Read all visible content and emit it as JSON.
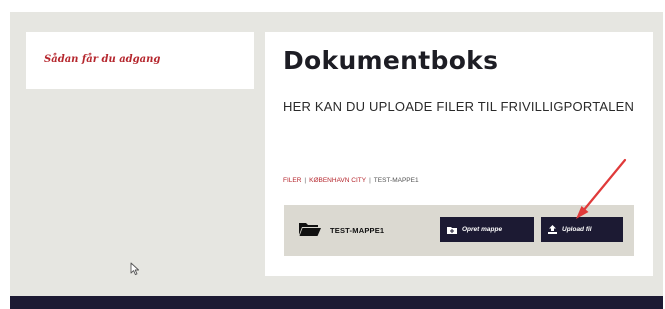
{
  "sidebar": {
    "link_label": "Sådan får du adgang"
  },
  "main": {
    "title": "Dokumentboks",
    "subtitle": "HER KAN DU UPLOADE FILER TIL FRIVILLIGPORTALEN",
    "breadcrumb": {
      "items": [
        "FILER",
        "KØBENHAVN CITY",
        "TEST-MAPPE1"
      ],
      "separator": "|"
    },
    "folder_bar": {
      "folder_name": "TEST-MAPPE1",
      "new_folder_label": "Opret mappe",
      "upload_label": "Upload fil"
    }
  },
  "colors": {
    "accent_red": "#b5262d",
    "navy": "#1c1a33",
    "stage_bg": "#e6e6e1",
    "folder_bar_bg": "#dbd9d1",
    "arrow_red": "#e03a3a"
  },
  "icons": [
    "folder-open-icon",
    "folder-plus-icon",
    "upload-icon",
    "mouse-cursor-icon",
    "annotation-arrow-icon"
  ]
}
